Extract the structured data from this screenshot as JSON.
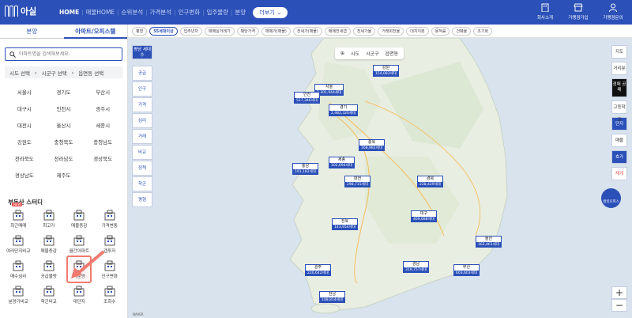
{
  "header": {
    "logo_text": "아실",
    "nav": [
      "HOME",
      "매물HOME",
      "순위분석",
      "가격분석",
      "인구변화",
      "입주물량",
      "분양"
    ],
    "more": "더보기",
    "right_items": [
      "회사소개",
      "가맹점가입",
      "가맹점문의"
    ]
  },
  "sidebar": {
    "tabs": [
      "분양",
      "아파트/오피스텔"
    ],
    "search_placeholder": "아파트명을 검색해보세요.",
    "region": [
      "시도 선택",
      "시군구 선택",
      "읍면동 선택"
    ],
    "cities": [
      "서울시",
      "경기도",
      "부산시",
      "대구시",
      "인천시",
      "광주시",
      "대전시",
      "울산시",
      "세종시",
      "강원도",
      "충청북도",
      "충청남도",
      "전라북도",
      "전라남도",
      "경상북도",
      "경상남도",
      "제주도"
    ],
    "study_title": "부동산 스터디",
    "study_items": [
      {
        "label": "최근매매",
        "icon": "house-icon",
        "new": true
      },
      {
        "label": "최고가",
        "icon": "trophy-icon",
        "new": false
      },
      {
        "label": "매물증감",
        "icon": "building-icon",
        "new": false
      },
      {
        "label": "가격변동",
        "icon": "price-chart-icon",
        "new": false
      },
      {
        "label": "여러단지비교",
        "icon": "compare-chart-icon",
        "new": false
      },
      {
        "label": "매물증감",
        "icon": "bar-chart-icon",
        "new": false
      },
      {
        "label": "월간아파트",
        "icon": "apartment-group-icon",
        "new": false
      },
      {
        "label": "갭투자",
        "icon": "gap-icon",
        "new": false
      },
      {
        "label": "매수심리",
        "icon": "heart-icon",
        "new": false
      },
      {
        "label": "공급물량",
        "icon": "supply-chart-icon",
        "new": false
      },
      {
        "label": "미분양",
        "icon": "unsold-building-icon",
        "new": false,
        "highlighted": true
      },
      {
        "label": "인구변화",
        "icon": "people-icon",
        "new": false
      },
      {
        "label": "분양가비교",
        "icon": "price-compare-icon",
        "new": false
      },
      {
        "label": "학군비교",
        "icon": "school-icon",
        "new": false
      },
      {
        "label": "대단지",
        "icon": "apartment-icon",
        "new": false
      },
      {
        "label": "조회수",
        "icon": "views-icon",
        "new": false
      }
    ]
  },
  "filterbar": [
    "평형",
    "55세대이상",
    "입주년차",
    "매매실거래가",
    "평당가격",
    "매매가(매물)",
    "전세가(매물)",
    "매매전세갭",
    "전세가율",
    "거래회전율",
    "대지지분",
    "용적률",
    "건폐율",
    "조기화"
  ],
  "filter_active": "55세대이상",
  "map": {
    "left_controls_top": "평당 세대수",
    "left_controls": [
      "공급",
      "인구",
      "가격",
      "심리",
      "거래",
      "비교",
      "정책",
      "학군",
      "평형"
    ],
    "mode_tabs": [
      "시도",
      "시군구",
      "읍면동"
    ],
    "right_controls": [
      "지도",
      "거리뷰",
      "경매 공매",
      "고등학교",
      "단지",
      "매물",
      "호가",
      "재개"
    ],
    "round_button": "랭킹오피스",
    "zoom": [
      "+",
      "−"
    ],
    "footer": "NAVER",
    "regions": [
      {
        "name": "서울",
        "value": "2,301,944세대"
      },
      {
        "name": "인천",
        "value": "517,346세대"
      },
      {
        "name": "강원",
        "value": "154,083세대"
      },
      {
        "name": "경기",
        "value": "2,482,320세대"
      },
      {
        "name": "충북",
        "value": "168,982세대"
      },
      {
        "name": "충남",
        "value": "191,182세대"
      },
      {
        "name": "세종",
        "value": "102,694세대"
      },
      {
        "name": "대전",
        "value": "298,715세대"
      },
      {
        "name": "경북",
        "value": "228,429세대"
      },
      {
        "name": "전북",
        "value": "143,954세대"
      },
      {
        "name": "대구",
        "value": "469,688세대"
      },
      {
        "name": "울산",
        "value": "162,461세대"
      },
      {
        "name": "광주",
        "value": "220,642세대"
      },
      {
        "name": "경남",
        "value": "319,757세대"
      },
      {
        "name": "부산",
        "value": "603,603세대"
      },
      {
        "name": "전남",
        "value": "108,814세대"
      }
    ]
  }
}
